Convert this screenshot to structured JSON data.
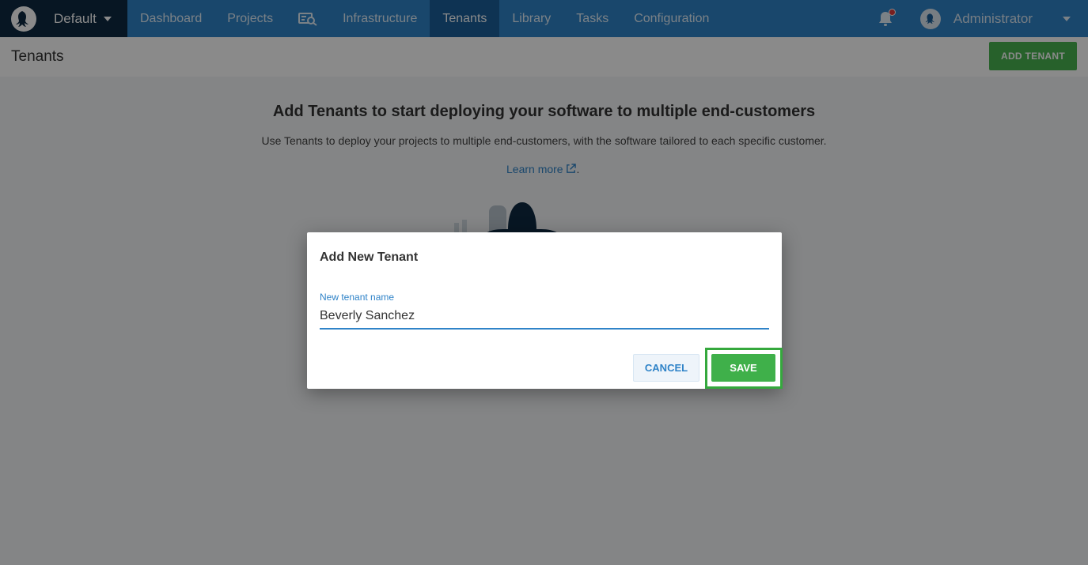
{
  "nav": {
    "space_name": "Default",
    "items": [
      {
        "label": "Dashboard",
        "active": false
      },
      {
        "label": "Projects",
        "active": false
      },
      {
        "label": "Infrastructure",
        "active": false
      },
      {
        "label": "Tenants",
        "active": true
      },
      {
        "label": "Library",
        "active": false
      },
      {
        "label": "Tasks",
        "active": false
      },
      {
        "label": "Configuration",
        "active": false
      }
    ],
    "search_icon": "search-icon",
    "notifications_icon": "bell-icon",
    "user_name": "Administrator"
  },
  "page": {
    "title": "Tenants",
    "add_button": "ADD TENANT"
  },
  "onboarding": {
    "title": "Add Tenants to start deploying your software to multiple end-customers",
    "description": "Use Tenants to deploy your projects to multiple end-customers, with the software tailored to each specific customer.",
    "learn_more": "Learn more",
    "learn_more_suffix": "."
  },
  "dialog": {
    "title": "Add New Tenant",
    "field_label": "New tenant name",
    "field_value": "Beverly Sanchez",
    "cancel_label": "CANCEL",
    "save_label": "SAVE"
  },
  "colors": {
    "nav_bg": "#2f83c8",
    "space_bg": "#0e2a42",
    "accent_green": "#3fb04a",
    "accent_blue": "#2f83c8"
  }
}
